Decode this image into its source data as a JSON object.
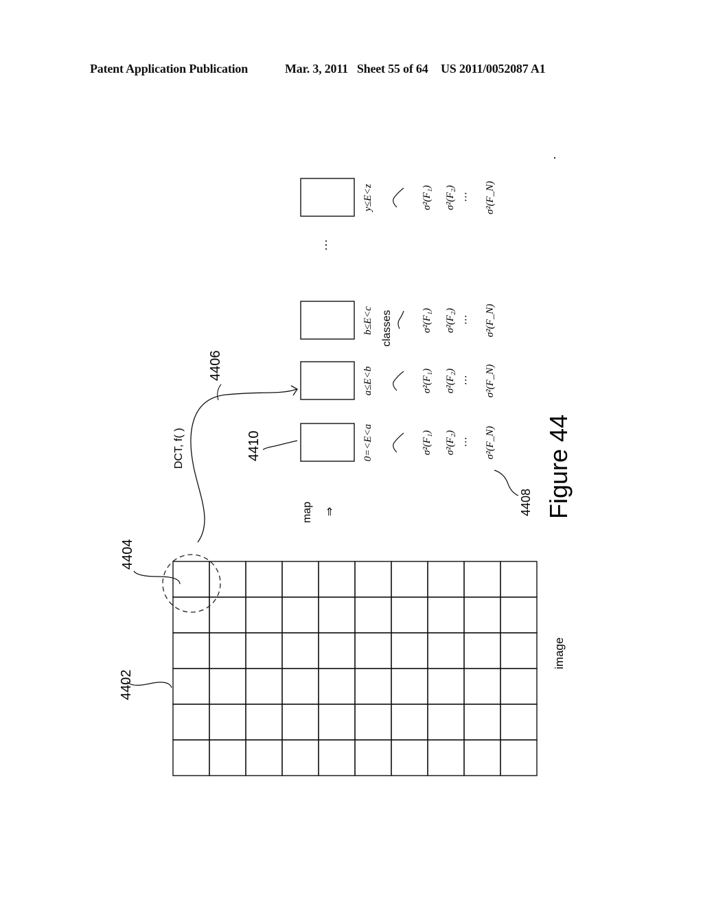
{
  "header": {
    "left": "Patent Application Publication",
    "date_sheet": "Mar. 3, 2011   Sheet 55 of 64",
    "patent_number": "US 2011/0052087 A1"
  },
  "figure": {
    "title": "Figure 44",
    "image_label": "image",
    "map_label": "map",
    "map_arrow": "⇒",
    "transform_label": "DCT, f( )",
    "classes_label": "classes",
    "ellipsis": "…",
    "grid": {
      "columns": 10,
      "rows": 6
    },
    "refs": {
      "image_grid": "4402",
      "block": "4404",
      "transform_arrow": "4406",
      "variance_list": "4408",
      "class_box": "4410"
    },
    "classes": [
      {
        "range": "0=<E<a",
        "variances": [
          "σ²(F₁)",
          "σ²(F₂)",
          "⋯",
          "σ²(F_N)"
        ]
      },
      {
        "range": "a≤E<b",
        "variances": [
          "σ²(F₁)",
          "σ²(F₂)",
          "⋯",
          "σ²(F_N)"
        ]
      },
      {
        "range": "b≤E<c",
        "variances": [
          "σ²(F₁)",
          "σ²(F₂)",
          "⋯",
          "σ²(F_N)"
        ]
      },
      {
        "range": "y≤E<z",
        "variances": [
          "σ²(F₁)",
          "σ²(F₂)",
          "⋯",
          "σ²(F_N)"
        ]
      }
    ]
  }
}
